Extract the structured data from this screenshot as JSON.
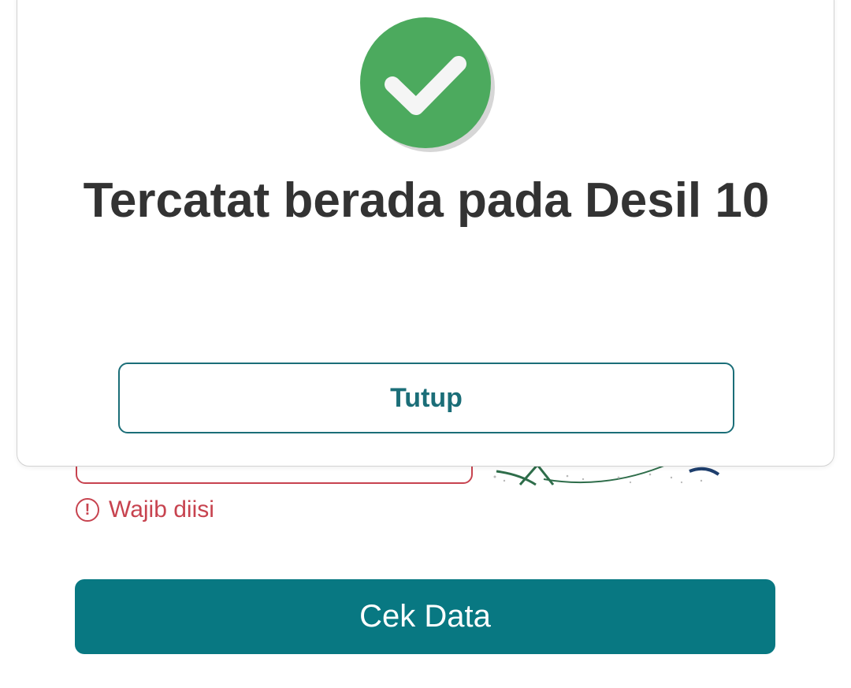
{
  "form": {
    "error_text": "Wajib diisi",
    "error_icon": "exclamation-circle-icon",
    "submit_label": "Cek Data"
  },
  "modal": {
    "status_icon": "check-circle-icon",
    "title": "Tercatat berada pada Desil 10",
    "close_label": "Tutup"
  },
  "colors": {
    "success": "#4caa5e",
    "primary": "#087882",
    "outline": "#1b6e78",
    "error": "#c7434f"
  }
}
